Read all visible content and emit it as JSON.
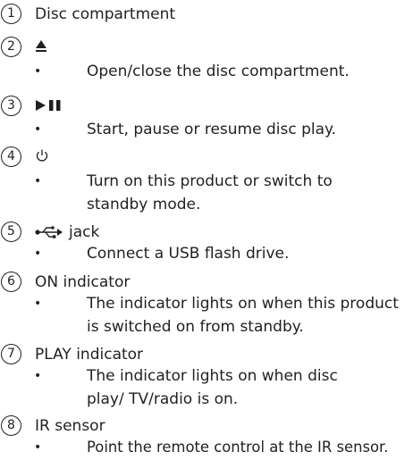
{
  "items": [
    {
      "num": "1",
      "title": "Disc compartment",
      "icon": "",
      "desc": ""
    },
    {
      "num": "2",
      "title": "",
      "icon": "eject-icon",
      "desc": "Open/close the disc compartment."
    },
    {
      "num": "3",
      "title": "",
      "icon": "play-pause-icon",
      "desc": "Start, pause or resume disc play."
    },
    {
      "num": "4",
      "title": "",
      "icon": "power-icon",
      "desc": "Turn on this product or switch to standby mode."
    },
    {
      "num": "5",
      "title": "jack",
      "icon": "usb-icon",
      "desc": "Connect a USB flash drive."
    },
    {
      "num": "6",
      "title": "ON indicator",
      "icon": "",
      "desc": "The indicator lights on when this product is switched on from standby."
    },
    {
      "num": "7",
      "title": "PLAY indicator",
      "icon": "",
      "desc": "The indicator lights on when disc play/ TV/radio is on."
    },
    {
      "num": "8",
      "title": "IR sensor",
      "icon": "",
      "desc": "Point the remote control at the IR sensor."
    }
  ],
  "bullet": "•"
}
